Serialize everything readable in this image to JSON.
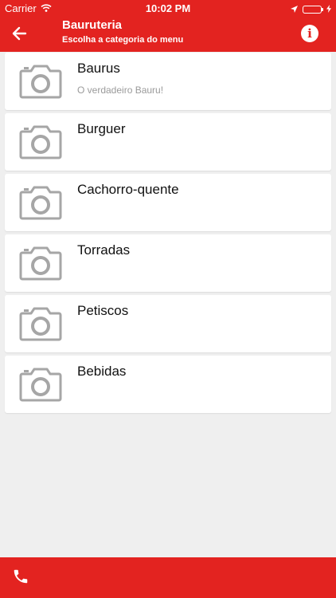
{
  "status_bar": {
    "carrier": "Carrier",
    "time": "10:02 PM"
  },
  "app_bar": {
    "title": "Bauruteria",
    "subtitle": "Escolha a categoria do menu",
    "info_label": "i"
  },
  "categories": [
    {
      "title": "Baurus",
      "subtitle": "O verdadeiro Bauru!"
    },
    {
      "title": "Burguer",
      "subtitle": ""
    },
    {
      "title": "Cachorro-quente",
      "subtitle": ""
    },
    {
      "title": "Torradas",
      "subtitle": ""
    },
    {
      "title": "Petiscos",
      "subtitle": ""
    },
    {
      "title": "Bebidas",
      "subtitle": ""
    }
  ],
  "icons": {
    "back": "arrow-left-icon",
    "info": "info-icon",
    "thumbnail": "camera-placeholder-icon",
    "phone": "phone-icon"
  },
  "colors": {
    "brand": "#e32320",
    "background": "#efefef",
    "card": "#ffffff",
    "subtitle": "#9a9a9a"
  }
}
